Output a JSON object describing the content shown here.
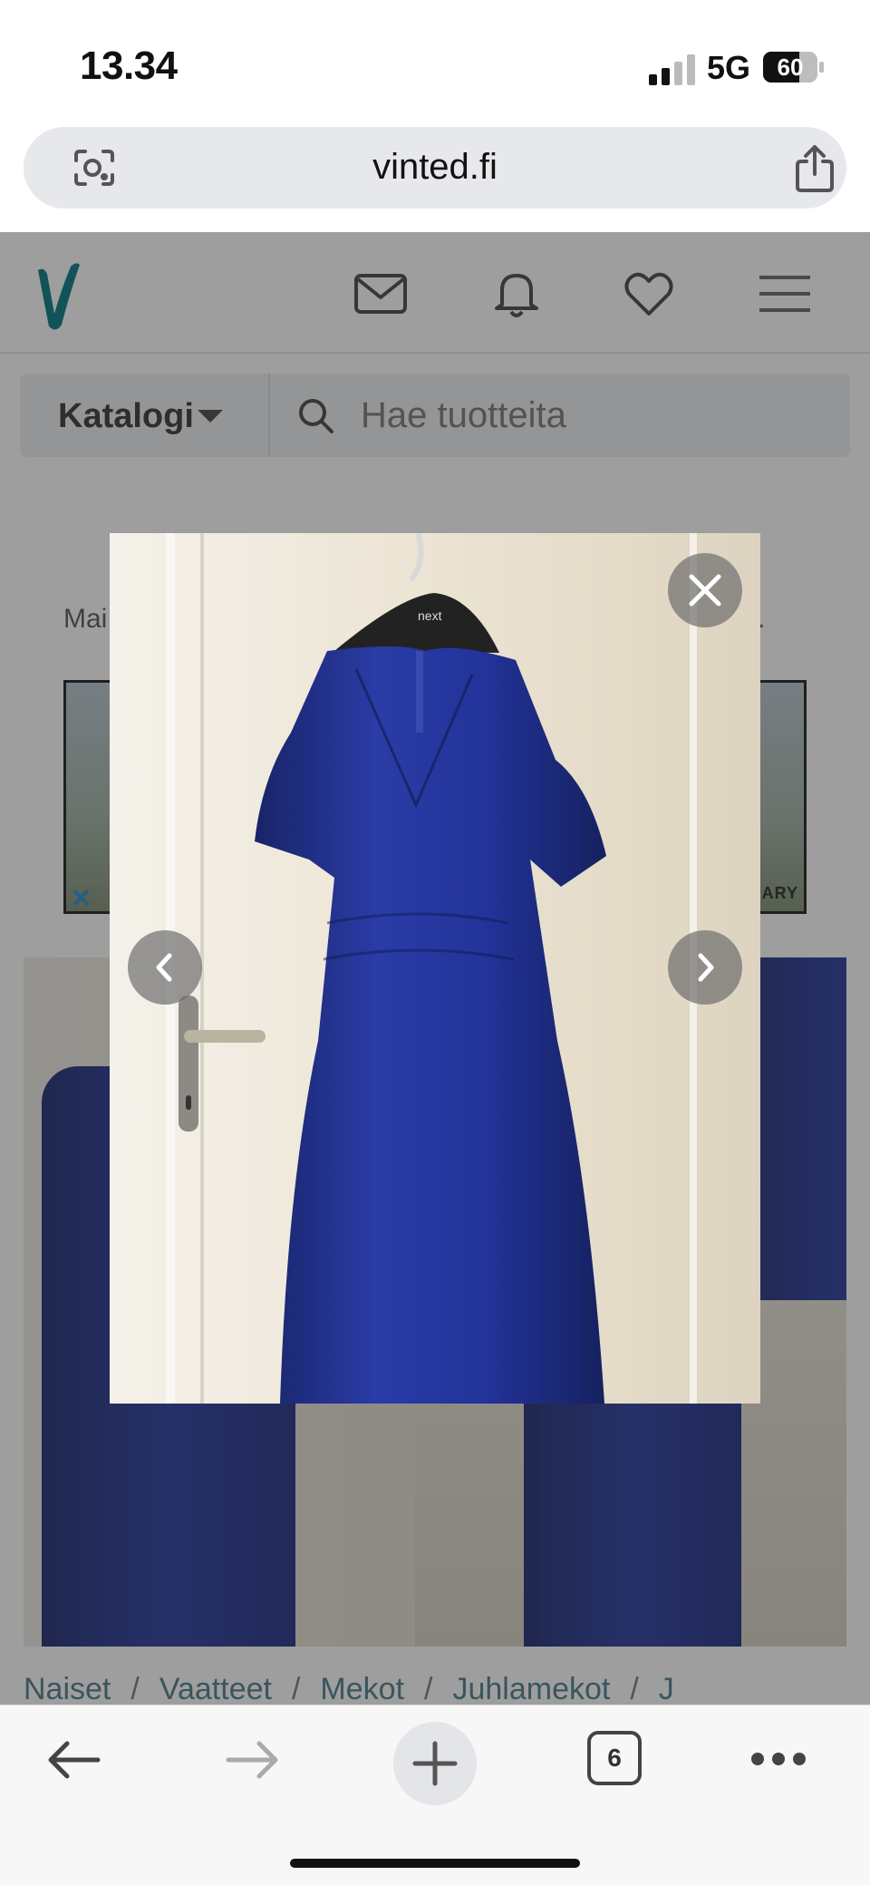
{
  "status_bar": {
    "time": "13.34",
    "network": "5G",
    "battery": "60"
  },
  "browser": {
    "url": "vinted.fi",
    "open_tabs": "6",
    "icons": [
      "lens-icon",
      "share-icon",
      "back-arrow-icon",
      "forward-arrow-icon",
      "new-tab-plus-icon",
      "tabs-icon",
      "more-dots-icon"
    ]
  },
  "header": {
    "logo": "V",
    "icons": [
      "mail-icon",
      "bell-icon",
      "heart-icon",
      "hamburger-menu-icon"
    ]
  },
  "search": {
    "catalog_label": "Katalogi",
    "placeholder": "Hae tuotteita"
  },
  "seller": {
    "prefix": "Mai",
    "suffix": "."
  },
  "ad": {
    "close_glyph": "×",
    "brand": "ARY"
  },
  "breadcrumb": {
    "items": [
      "Naiset",
      "Vaatteet",
      "Mekot",
      "Juhlamekot",
      "J"
    ]
  },
  "lightbox": {
    "hanger_brand": "next",
    "controls": [
      "close-icon",
      "chevron-left-icon",
      "chevron-right-icon"
    ]
  },
  "colors": {
    "brand": "#007782",
    "dress": "#1f2f8c",
    "overlay": "rgba(40,40,40,0.45)"
  }
}
